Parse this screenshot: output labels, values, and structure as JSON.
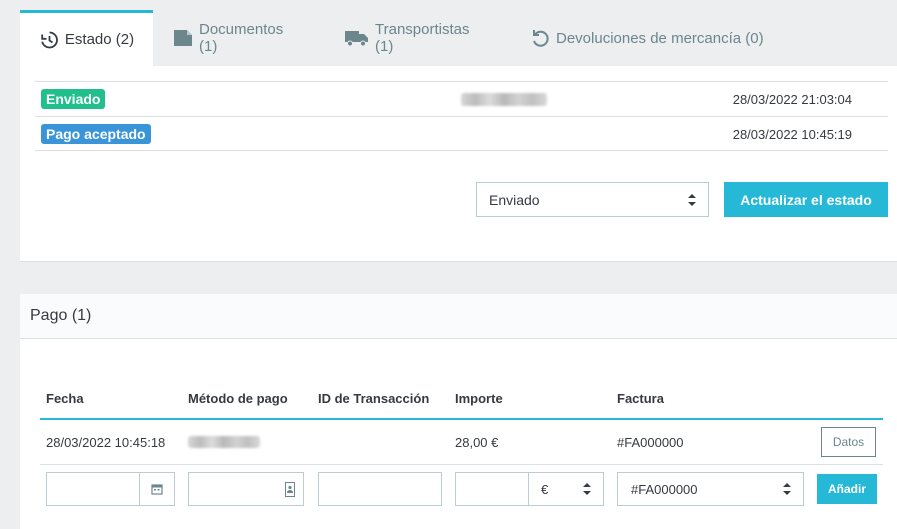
{
  "tabs": [
    {
      "label": "Estado (2)",
      "icon": "history-icon"
    },
    {
      "label": "Documentos (1)",
      "icon": "document-icon"
    },
    {
      "label": "Transportistas (1)",
      "icon": "truck-icon"
    },
    {
      "label": "Devoluciones de mercancía (0)",
      "icon": "undo-icon"
    }
  ],
  "history": [
    {
      "status": "Enviado",
      "color": "#21bf8c",
      "date": "28/03/2022 21:03:04"
    },
    {
      "status": "Pago aceptado",
      "color": "#3a94d8",
      "date": "28/03/2022 10:45:19"
    }
  ],
  "status_form": {
    "selected": "Enviado",
    "update_label": "Actualizar el estado"
  },
  "payment": {
    "title": "Pago (1)",
    "columns": [
      "Fecha",
      "Método de pago",
      "ID de Transacción",
      "Importe",
      "Factura"
    ],
    "rows": [
      {
        "date": "28/03/2022 10:45:18",
        "method": "",
        "transaction_id": "",
        "amount": "28,00 €",
        "invoice": "#FA000000",
        "details_label": "Datos"
      }
    ],
    "new_row": {
      "currency": "€",
      "invoice": "#FA000000",
      "add_label": "Añadir"
    }
  },
  "colors": {
    "accent": "#25b9d7",
    "success": "#21bf8c",
    "info": "#3a94d8"
  }
}
